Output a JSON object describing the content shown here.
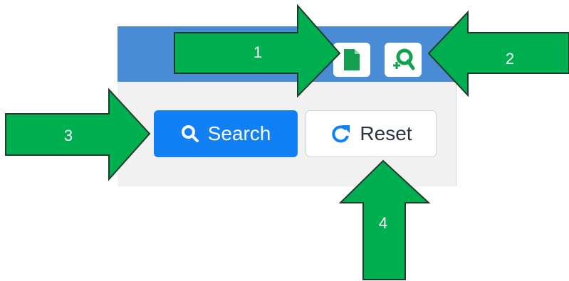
{
  "toolbar": {
    "document_icon": "document-icon",
    "zoom_add_icon": "magnify-plus-icon"
  },
  "buttons": {
    "search_label": "Search",
    "search_icon": "search-icon",
    "reset_label": "Reset",
    "reset_icon": "refresh-icon"
  },
  "callouts": {
    "one": "1",
    "two": "2",
    "three": "3",
    "four": "4"
  },
  "colors": {
    "header_blue": "#4a8bd6",
    "search_blue": "#1280f5",
    "arrow_green": "#00b050",
    "icon_green": "#12a150"
  }
}
